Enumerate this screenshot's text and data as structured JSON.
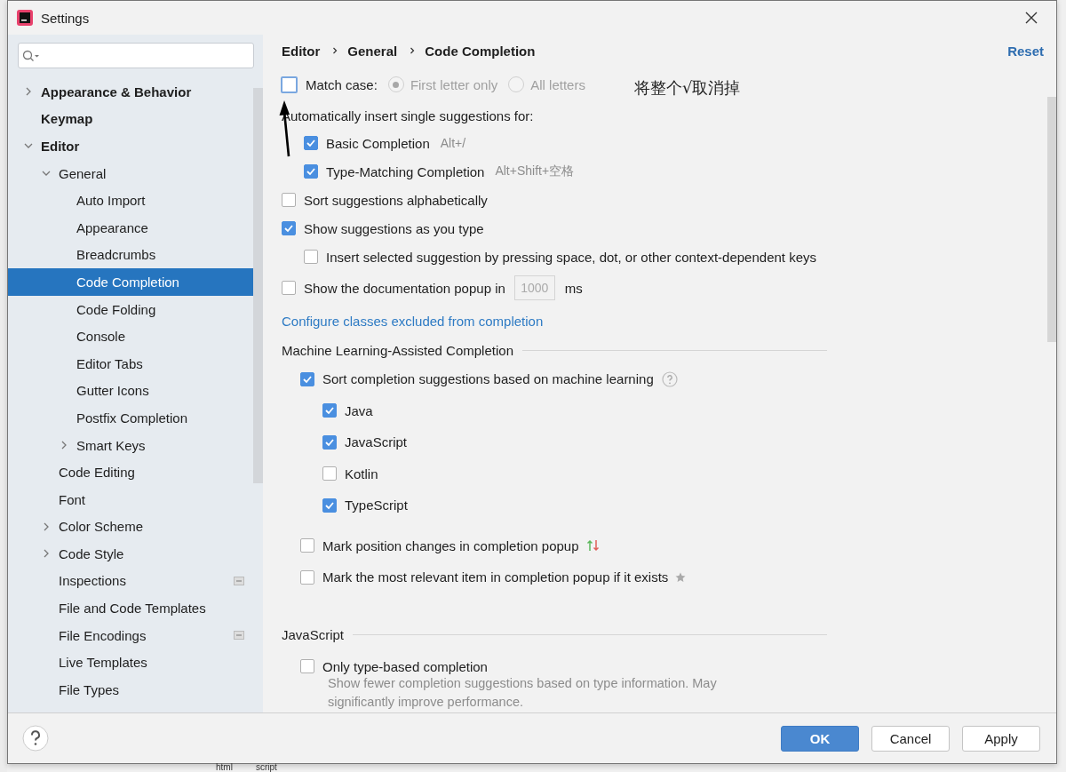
{
  "window": {
    "title": "Settings"
  },
  "sidebar": {
    "items": [
      {
        "label": "Appearance & Behavior",
        "expanded": false,
        "selected": false
      },
      {
        "label": "Keymap",
        "selected": false
      },
      {
        "label": "Editor",
        "expanded": true,
        "selected": false,
        "children": [
          {
            "label": "General",
            "expanded": true,
            "selected": false,
            "children": [
              {
                "label": "Auto Import",
                "selected": false
              },
              {
                "label": "Appearance",
                "selected": false
              },
              {
                "label": "Breadcrumbs",
                "selected": false
              },
              {
                "label": "Code Completion",
                "selected": true
              },
              {
                "label": "Code Folding",
                "selected": false
              },
              {
                "label": "Console",
                "selected": false
              },
              {
                "label": "Editor Tabs",
                "selected": false
              },
              {
                "label": "Gutter Icons",
                "selected": false
              },
              {
                "label": "Postfix Completion",
                "selected": false
              },
              {
                "label": "Smart Keys",
                "expanded": false,
                "selected": false
              }
            ]
          },
          {
            "label": "Code Editing",
            "selected": false
          },
          {
            "label": "Font",
            "selected": false
          },
          {
            "label": "Color Scheme",
            "expanded": false,
            "selected": false
          },
          {
            "label": "Code Style",
            "expanded": false,
            "selected": false
          },
          {
            "label": "Inspections",
            "scope_icon": true,
            "selected": false
          },
          {
            "label": "File and Code Templates",
            "selected": false
          },
          {
            "label": "File Encodings",
            "scope_icon": true,
            "selected": false
          },
          {
            "label": "Live Templates",
            "selected": false
          },
          {
            "label": "File Types",
            "selected": false
          }
        ]
      }
    ]
  },
  "breadcrumb": [
    "Editor",
    "General",
    "Code Completion"
  ],
  "reset": "Reset",
  "options": [
    {
      "kind": "match_case",
      "label": "Match case:",
      "checked": false,
      "radios": [
        {
          "label": "First letter only",
          "selected": true,
          "disabled": true
        },
        {
          "label": "All letters",
          "selected": false,
          "disabled": true
        }
      ]
    },
    {
      "kind": "heading",
      "label": "Automatically insert single suggestions for:",
      "children": [
        {
          "kind": "checkbox",
          "label": "Basic Completion",
          "checked": true,
          "shortcut": "Alt+/"
        },
        {
          "kind": "checkbox",
          "label": "Type-Matching Completion",
          "checked": true,
          "shortcut": "Alt+Shift+空格"
        }
      ]
    },
    {
      "kind": "checkbox",
      "label": "Sort suggestions alphabetically",
      "checked": false
    },
    {
      "kind": "checkbox",
      "label": "Show suggestions as you type",
      "checked": true,
      "children": [
        {
          "kind": "checkbox",
          "label": "Insert selected suggestion by pressing space, dot, or other context-dependent keys",
          "checked": false
        }
      ]
    },
    {
      "kind": "number",
      "label": "Show the documentation popup in",
      "checked": false,
      "value": "1000",
      "unit": "ms"
    },
    {
      "kind": "link",
      "label": "Configure classes excluded from completion"
    },
    {
      "kind": "section",
      "label": "Machine Learning-Assisted Completion",
      "children": [
        {
          "kind": "checkbox",
          "label": "Sort completion suggestions based on machine learning",
          "checked": true,
          "help": true,
          "children": [
            {
              "kind": "checkbox",
              "label": "Java",
              "checked": true
            },
            {
              "kind": "checkbox",
              "label": "JavaScript",
              "checked": true
            },
            {
              "kind": "checkbox",
              "label": "Kotlin",
              "checked": false
            },
            {
              "kind": "checkbox",
              "label": "TypeScript",
              "checked": true
            }
          ]
        },
        {
          "kind": "checkbox",
          "label": "Mark position changes in completion popup",
          "checked": false,
          "arrows_icon": true
        },
        {
          "kind": "checkbox",
          "label": "Mark the most relevant item in completion popup if it exists",
          "checked": false,
          "star_icon": true
        }
      ]
    },
    {
      "kind": "section",
      "label": "JavaScript",
      "children": [
        {
          "kind": "checkbox",
          "label": "Only type-based completion",
          "checked": false,
          "description": "Show fewer completion suggestions based on type information. May significantly improve performance."
        }
      ]
    }
  ],
  "annotation": {
    "text": "将整个√取消掉"
  },
  "buttons": [
    {
      "label": "OK",
      "primary": true
    },
    {
      "label": "Cancel",
      "primary": false
    },
    {
      "label": "Apply",
      "primary": false
    }
  ],
  "background_editor": {
    "breadcrumb": [
      "html",
      "script"
    ]
  }
}
